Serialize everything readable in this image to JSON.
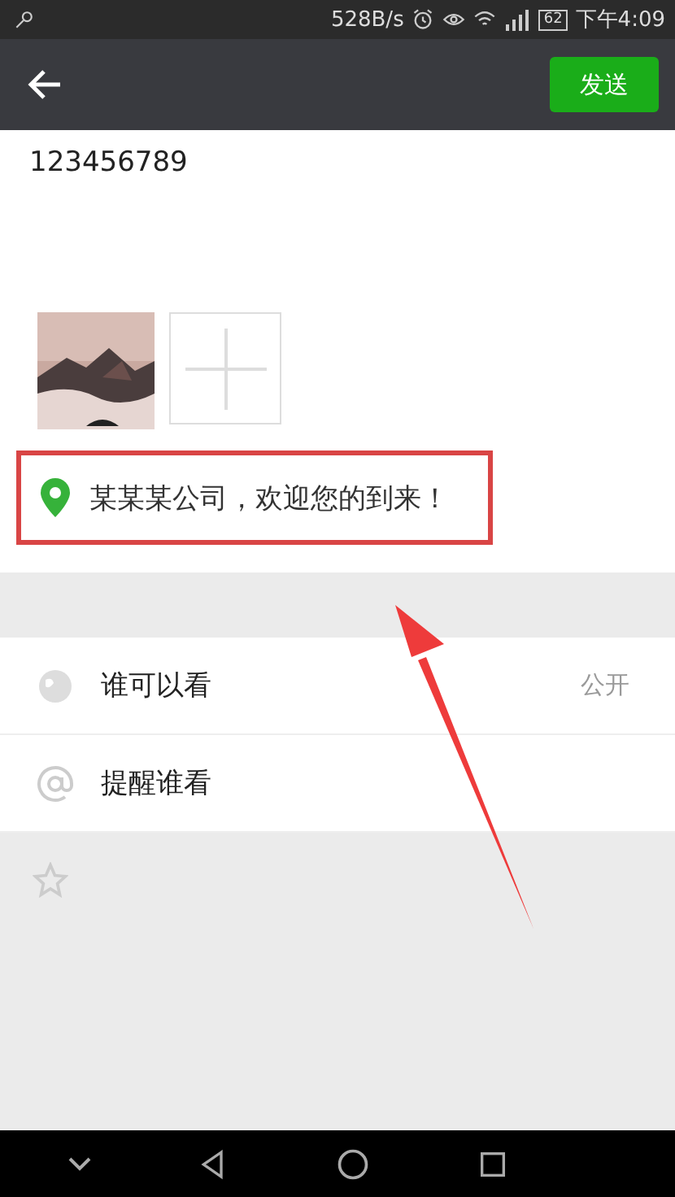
{
  "status_bar": {
    "speed": "528B/s",
    "battery": "62",
    "time": "下午4:09"
  },
  "toolbar": {
    "send_button": "发送"
  },
  "post": {
    "text": "123456789",
    "photos": [
      {
        "kind": "picture"
      },
      {
        "kind": "add"
      }
    ]
  },
  "location": {
    "text": "某某某公司，欢迎您的到来！",
    "highlighted": true
  },
  "options": [
    {
      "kind": "visibility",
      "label": "谁可以看",
      "value": "公开"
    },
    {
      "kind": "mention",
      "label": "提醒谁看"
    }
  ],
  "extra": [
    {
      "kind": "star"
    }
  ]
}
